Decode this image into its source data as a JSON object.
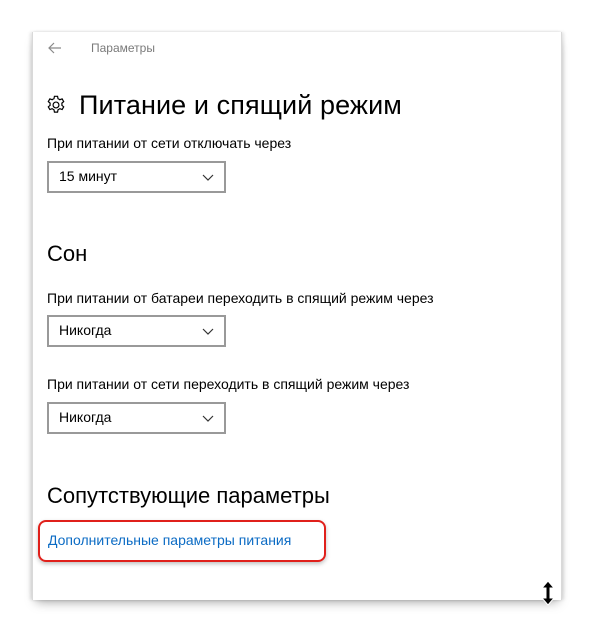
{
  "window": {
    "title": "Параметры"
  },
  "page": {
    "title": "Питание и спящий режим"
  },
  "screen": {
    "label": "При питании от сети отключать через",
    "value": "15 минут"
  },
  "sleep": {
    "section_title": "Сон",
    "battery_label": "При питании от батареи переходить в спящий режим через",
    "battery_value": "Никогда",
    "ac_label": "При питании от сети переходить в спящий режим через",
    "ac_value": "Никогда"
  },
  "related": {
    "section_title": "Сопутствующие параметры",
    "link_label": "Дополнительные параметры питания"
  },
  "icons": {
    "back": "back-arrow-icon",
    "settings": "gear-icon",
    "dropdown": "chevron-down-icon",
    "cursor": "resize-cursor-icon"
  },
  "colors": {
    "link": "#0b6bc4",
    "highlight": "#e0201b",
    "dropdown_border": "#999999",
    "muted_text": "#7a7a7a"
  }
}
